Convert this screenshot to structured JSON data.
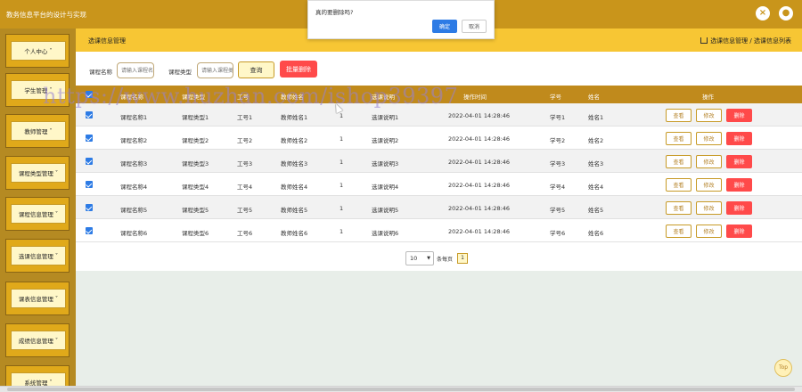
{
  "app": {
    "title": "教务信息平台的设计与实现"
  },
  "topbar": {
    "close_icon": "close-icon",
    "user_icon": "user-icon"
  },
  "sidebar": {
    "items": [
      {
        "label": "个人中心"
      },
      {
        "label": "学生管理"
      },
      {
        "label": "教师管理"
      },
      {
        "label": "课程类型管理"
      },
      {
        "label": "课程信息管理"
      },
      {
        "label": "选课信息管理"
      },
      {
        "label": "课表信息管理"
      },
      {
        "label": "成绩信息管理"
      },
      {
        "label": "系统管理"
      }
    ]
  },
  "header": {
    "title": "选课信息管理",
    "breadcrumb": "选课信息管理 / 选课信息列表"
  },
  "search": {
    "course_name_label": "课程名称",
    "course_name_placeholder": "请输入课程名",
    "course_type_label": "课程类型",
    "course_type_placeholder": "请输入课程类",
    "query_label": "查询",
    "batch_delete_label": "批量删除"
  },
  "table": {
    "columns": [
      "课程名称",
      "课程类型",
      "工号",
      "教师姓名",
      "",
      "选课说明",
      "操作时间",
      "学号",
      "姓名",
      "操作"
    ],
    "rows": [
      {
        "name": "课程名称1",
        "type": "课程类型1",
        "no": "工号1",
        "teacher": "教师姓名1",
        "count": "1",
        "note": "选课说明1",
        "time": "2022-04-01 14:28:46",
        "sid": "学号1",
        "sname": "姓名1"
      },
      {
        "name": "课程名称2",
        "type": "课程类型2",
        "no": "工号2",
        "teacher": "教师姓名2",
        "count": "1",
        "note": "选课说明2",
        "time": "2022-04-01 14:28:46",
        "sid": "学号2",
        "sname": "姓名2"
      },
      {
        "name": "课程名称3",
        "type": "课程类型3",
        "no": "工号3",
        "teacher": "教师姓名3",
        "count": "1",
        "note": "选课说明3",
        "time": "2022-04-01 14:28:46",
        "sid": "学号3",
        "sname": "姓名3"
      },
      {
        "name": "课程名称4",
        "type": "课程类型4",
        "no": "工号4",
        "teacher": "教师姓名4",
        "count": "1",
        "note": "选课说明4",
        "time": "2022-04-01 14:28:46",
        "sid": "学号4",
        "sname": "姓名4"
      },
      {
        "name": "课程名称5",
        "type": "课程类型5",
        "no": "工号5",
        "teacher": "教师姓名5",
        "count": "1",
        "note": "选课说明5",
        "time": "2022-04-01 14:28:46",
        "sid": "学号5",
        "sname": "姓名5"
      },
      {
        "name": "课程名称6",
        "type": "课程类型6",
        "no": "工号6",
        "teacher": "教师姓名6",
        "count": "1",
        "note": "选课说明6",
        "time": "2022-04-01 14:28:46",
        "sid": "学号6",
        "sname": "姓名6"
      }
    ],
    "view_label": "查看",
    "edit_label": "修改",
    "delete_label": "删除"
  },
  "pager": {
    "page_size": "10",
    "per_page_label": "条每页",
    "current_page": "1"
  },
  "fab": {
    "top_label": "Top"
  },
  "dialog": {
    "message": "真的要删除吗?",
    "ok_label": "确定",
    "cancel_label": "取消"
  },
  "watermark": {
    "text": "https://www.huzhan.com/ishop39397"
  },
  "colors": {
    "accent": "#c9951b",
    "header_band": "#f7c634",
    "danger": "#ff4a4a",
    "primary": "#2d7be5"
  }
}
